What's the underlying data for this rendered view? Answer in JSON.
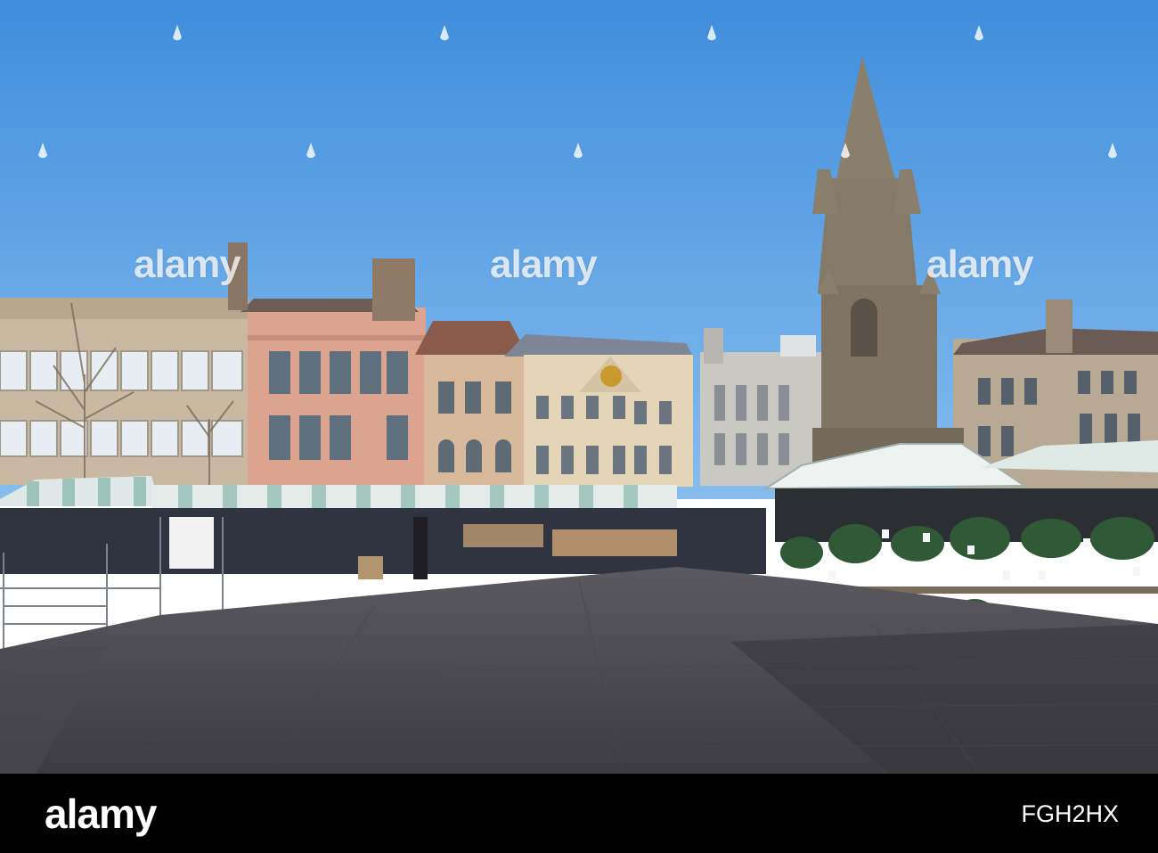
{
  "watermark": {
    "text": "alamy"
  },
  "footer": {
    "logo": "alamy",
    "image_id": "FGH2HX"
  },
  "colors": {
    "sky": "#4f98e0",
    "pavement": "#4d4c52",
    "bar": "#000000"
  }
}
